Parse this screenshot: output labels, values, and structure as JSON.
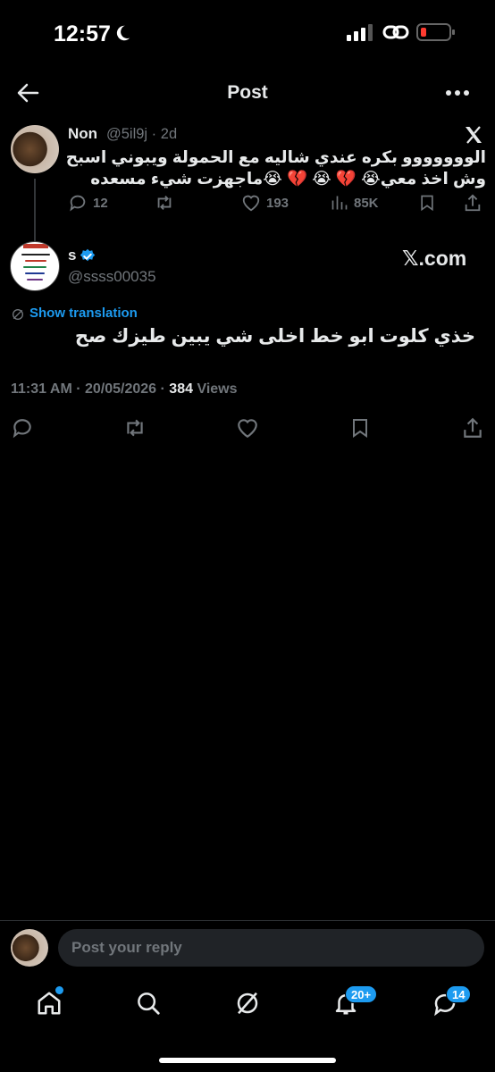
{
  "status": {
    "time": "12:57"
  },
  "header": {
    "title": "Post"
  },
  "quoted_tweet": {
    "name": "Non",
    "handle_time": "@5il9j · 2d",
    "text": "الووووووو بكره عندي شاليه مع الحمولة ويبوني اسبح وش اخذ معي😭 💔 😭 💔 😭ماجهزت شيء مسعده",
    "replies": "12",
    "likes": "193",
    "views": "85K"
  },
  "main_tweet": {
    "name": "s",
    "handle": "@ssss00035",
    "brand_text": "𝕏.com",
    "translate_label": "Show translation",
    "text": "خذي كلوت ابو خط اخلى شي يبين طيزك صح",
    "timestamp": "11:31 AM · 20/05/2026 · ",
    "views_count": "384",
    "views_label": " Views"
  },
  "reply": {
    "placeholder": "Post your reply"
  },
  "nav": {
    "notifications_badge": "20+",
    "messages_badge": "14"
  },
  "colors": {
    "accent": "#1d9bf0",
    "muted": "#71767b",
    "text": "#e7e9ea",
    "background": "#000000"
  },
  "icons": [
    "moon-icon",
    "signal-icon",
    "link-icon",
    "battery-icon",
    "back-arrow-icon",
    "more-icon",
    "x-logo-icon",
    "reply-icon",
    "retweet-icon",
    "like-icon",
    "views-icon",
    "bookmark-icon",
    "share-icon",
    "verified-icon",
    "translate-icon",
    "home-icon",
    "search-icon",
    "grok-icon",
    "bell-icon",
    "messages-icon"
  ]
}
